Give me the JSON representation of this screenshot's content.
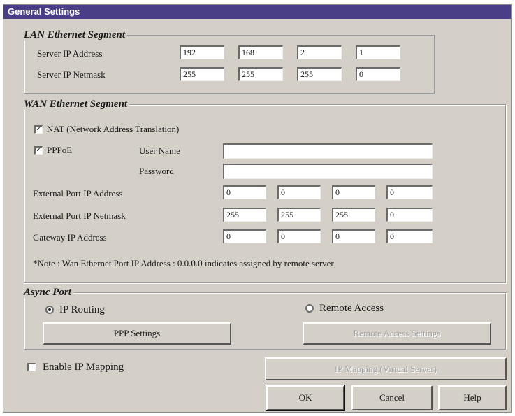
{
  "window": {
    "title": "General Settings"
  },
  "lan": {
    "legend": "LAN Ethernet Segment",
    "server_ip_label": "Server IP Address",
    "server_ip": [
      "192",
      "168",
      "2",
      "1"
    ],
    "netmask_label": "Server IP Netmask",
    "netmask": [
      "255",
      "255",
      "255",
      "0"
    ]
  },
  "wan": {
    "legend": "WAN Ethernet Segment",
    "nat": {
      "label": "NAT (Network Address Translation)",
      "checked": true
    },
    "pppoe": {
      "label": "PPPoE",
      "checked": true
    },
    "user_name_label": "User Name",
    "user_name_value": "",
    "password_label": "Password",
    "password_value": "",
    "ext_ip_label": "External Port IP Address",
    "ext_ip": [
      "0",
      "0",
      "0",
      "0"
    ],
    "ext_mask_label": "External Port IP Netmask",
    "ext_mask": [
      "255",
      "255",
      "255",
      "0"
    ],
    "gateway_label": "Gateway IP Address",
    "gateway": [
      "0",
      "0",
      "0",
      "0"
    ],
    "note": "*Note : Wan Ethernet Port IP Address : 0.0.0.0  indicates assigned by remote server"
  },
  "async": {
    "legend": "Async Port",
    "ip_routing_label": "IP Routing",
    "ip_routing_selected": true,
    "remote_access_label": "Remote Access",
    "remote_access_selected": false,
    "ppp_settings_label": "PPP Settings",
    "remote_access_settings_label": "Remote Access Settings"
  },
  "ip_mapping": {
    "label": "Enable IP Mapping",
    "checked": false,
    "button_label": "IP Mapping (Virtual Server)"
  },
  "buttons": {
    "ok": "OK",
    "cancel": "Cancel",
    "help": "Help"
  }
}
